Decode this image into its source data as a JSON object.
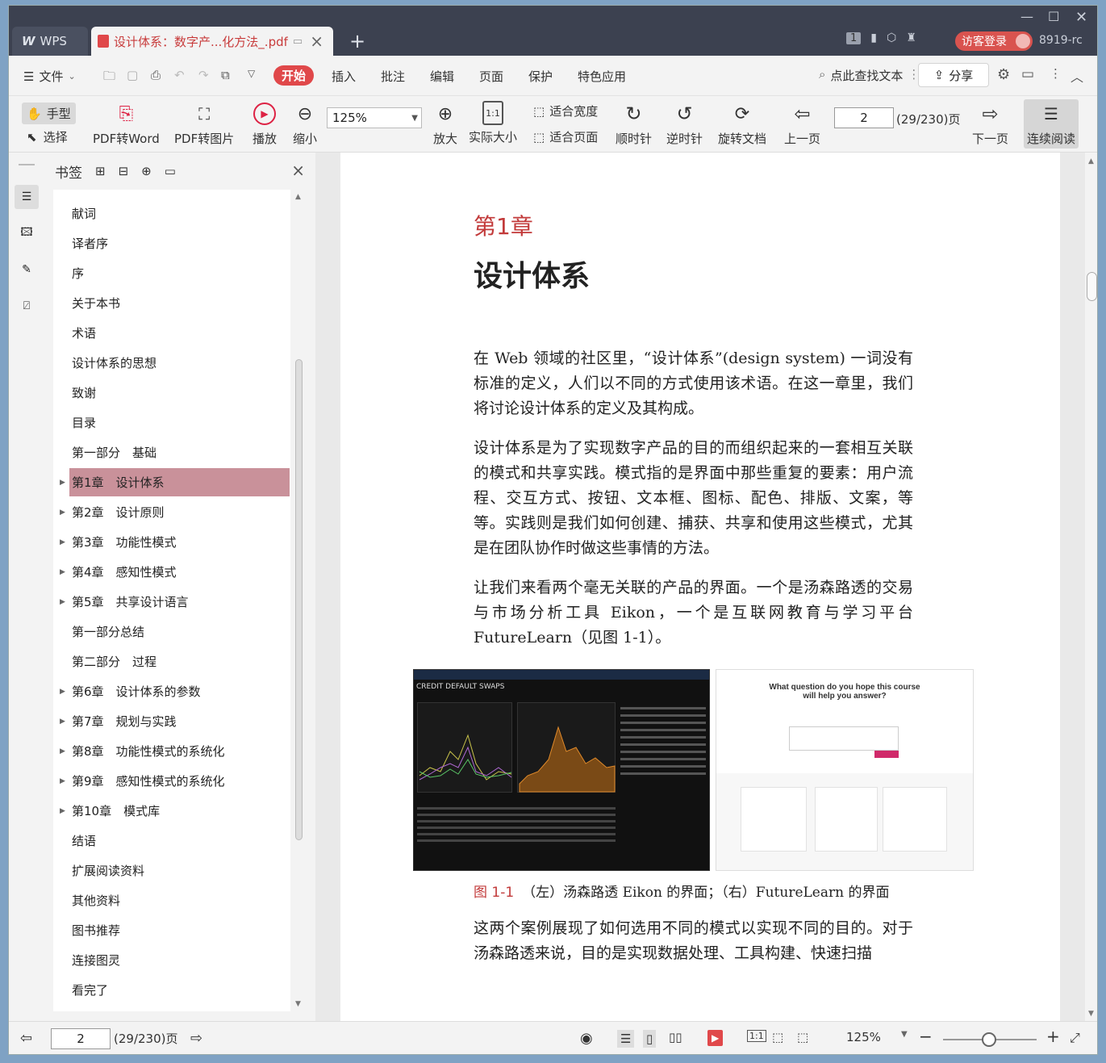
{
  "titlebar": {
    "wps_label": "WPS",
    "doc_tab_title": "设计体系：数字产...化方法_.pdf",
    "badge": "1",
    "guest_label": "访客登录",
    "user_id": "8919-rc"
  },
  "menu": {
    "file": "文件",
    "items": [
      "开始",
      "插入",
      "批注",
      "编辑",
      "页面",
      "保护",
      "特色应用"
    ],
    "search": "点此查找文本",
    "share": "分享"
  },
  "toolbar": {
    "hand": "手型",
    "select": "选择",
    "pdf_word": "PDF转Word",
    "pdf_image": "PDF转图片",
    "play": "播放",
    "zoom_out": "缩小",
    "zoom": "125%",
    "zoom_in": "放大",
    "actual": "实际大小",
    "fit_width": "适合宽度",
    "fit_page": "适合页面",
    "cw": "顺时针",
    "ccw": "逆时针",
    "rotate": "旋转文档",
    "prev": "上一页",
    "page": "2",
    "page_total": "(29/230)页",
    "next": "下一页",
    "continuous": "连续阅读"
  },
  "panel": {
    "title": "书签"
  },
  "bookmarks": [
    {
      "label": "献词",
      "arrow": ""
    },
    {
      "label": "译者序",
      "arrow": ""
    },
    {
      "label": "序",
      "arrow": ""
    },
    {
      "label": "关于本书",
      "arrow": ""
    },
    {
      "label": "术语",
      "arrow": ""
    },
    {
      "label": "设计体系的思想",
      "arrow": ""
    },
    {
      "label": "致谢",
      "arrow": ""
    },
    {
      "label": "目录",
      "arrow": ""
    },
    {
      "label": "第一部分　基础",
      "arrow": ""
    },
    {
      "label": "第1章　设计体系",
      "arrow": "▶"
    },
    {
      "label": "第2章　设计原则",
      "arrow": "▶"
    },
    {
      "label": "第3章　功能性模式",
      "arrow": "▶"
    },
    {
      "label": "第4章　感知性模式",
      "arrow": "▶"
    },
    {
      "label": "第5章　共享设计语言",
      "arrow": "▶"
    },
    {
      "label": "第一部分总结",
      "arrow": ""
    },
    {
      "label": "第二部分　过程",
      "arrow": ""
    },
    {
      "label": "第6章　设计体系的参数",
      "arrow": "▶"
    },
    {
      "label": "第7章　规划与实践",
      "arrow": "▶"
    },
    {
      "label": "第8章　功能性模式的系统化",
      "arrow": "▶"
    },
    {
      "label": "第9章　感知性模式的系统化",
      "arrow": "▶"
    },
    {
      "label": "第10章　模式库",
      "arrow": "▶"
    },
    {
      "label": "结语",
      "arrow": ""
    },
    {
      "label": "扩展阅读资料",
      "arrow": ""
    },
    {
      "label": "其他资料",
      "arrow": ""
    },
    {
      "label": "图书推荐",
      "arrow": ""
    },
    {
      "label": "连接图灵",
      "arrow": ""
    },
    {
      "label": "看完了",
      "arrow": ""
    }
  ],
  "page": {
    "chapter_num": "第1章",
    "chapter_title": "设计体系",
    "p1": "在 Web 领域的社区里，“设计体系”(design system) 一词没有标准的定义，人们以不同的方式使用该术语。在这一章里，我们将讨论设计体系的定义及其构成。",
    "p2": "设计体系是为了实现数字产品的目的而组织起来的一套相互关联的模式和共享实践。模式指的是界面中那些重复的要素：用户流程、交互方式、按钮、文本框、图标、配色、排版、文案，等等。实践则是我们如何创建、捕获、共享和使用这些模式，尤其是在团队协作时做这些事情的方法。",
    "p3": "让我们来看两个毫无关联的产品的界面。一个是汤森路透的交易与市场分析工具 Eikon，一个是互联网教育与学习平台 FutureLearn（见图 1-1）。",
    "caption_label": "图 1-1",
    "caption": "（左）汤森路透 Eikon 的界面；（右）FutureLearn 的界面",
    "p4": "这两个案例展现了如何选用不同的模式以实现不同的目的。对于汤森路透来说，目的是实现数据处理、工具构建、快速扫描"
  },
  "figure": {
    "left_title": "CREDIT DEFAULT SWAPS",
    "right_title": "What question do you hope this course will help you answer?"
  },
  "status": {
    "page": "2",
    "page_total": "(29/230)页",
    "zoom": "125%"
  }
}
